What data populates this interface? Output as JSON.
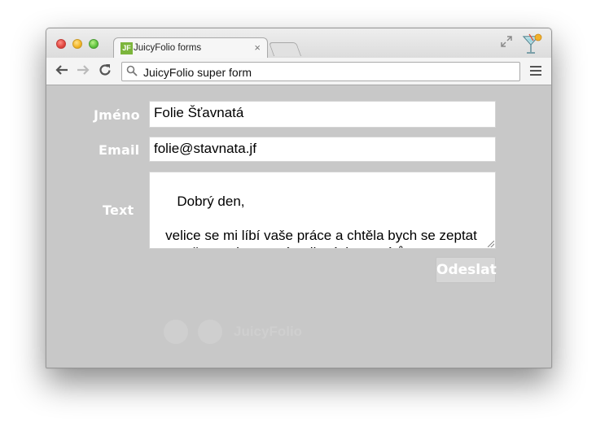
{
  "browser": {
    "tab": {
      "favicon_text": "JF",
      "title": "JuicyFolio forms",
      "close_glyph": "×"
    },
    "address_bar": {
      "url": "JuicyFolio super form"
    },
    "icons": {
      "back": "back-arrow-icon",
      "forward": "forward-arrow-icon",
      "reload": "reload-icon",
      "menu": "menu-icon",
      "fullscreen": "fullscreen-icon",
      "extension": "cocktail-icon"
    }
  },
  "form": {
    "name_label": "Jméno",
    "name_value": "Folie Šťavnatá",
    "email_label": "Email",
    "email_value": "folie@stavnata.jf",
    "text_label": "Text",
    "text_value": "Dobrý den,\n\n   velice se mi líbí vaše práce a chtěla bych se zeptat na možnost zhotovení rodinných portrétů..",
    "submit_label": "Odeslat"
  },
  "footer": {
    "brand": "JuicyFolio"
  },
  "colors": {
    "page_background": "#c8c8c8",
    "label_text": "#ffffff",
    "favicon_green": "#7cb53c"
  }
}
